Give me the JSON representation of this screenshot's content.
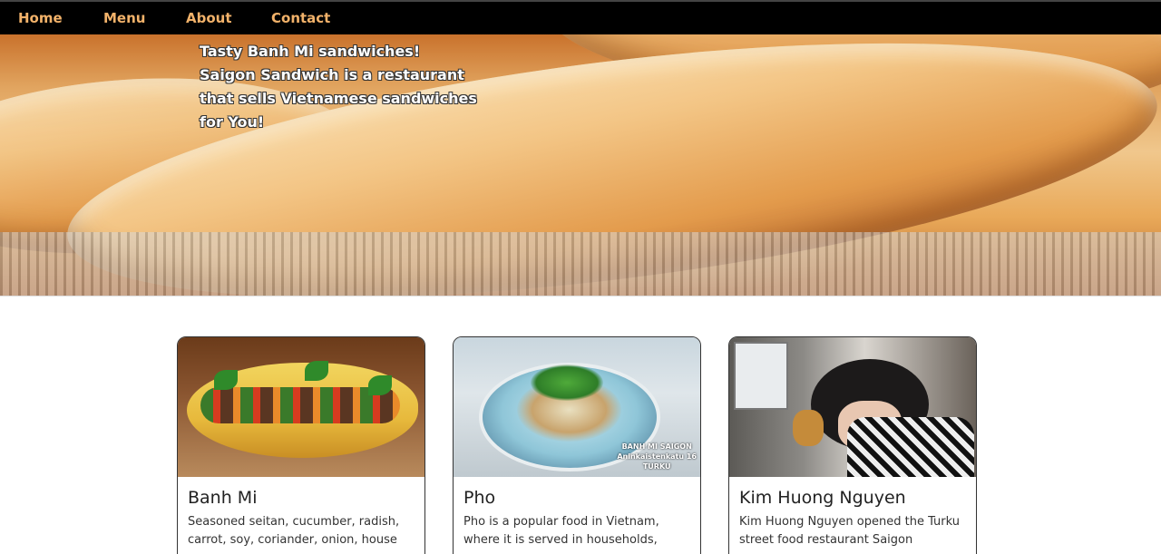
{
  "nav": {
    "items": [
      {
        "label": "Home"
      },
      {
        "label": "Menu"
      },
      {
        "label": "About"
      },
      {
        "label": "Contact"
      }
    ],
    "link_color": "#f2b26a",
    "background": "#000000"
  },
  "hero": {
    "lines": [
      "Tasty Banh Mi sandwiches!",
      "Saigon Sandwich is a restaurant",
      "that sells Vietnamese sandwiches",
      "for You!"
    ]
  },
  "cards": [
    {
      "title": "Banh Mi",
      "description": "Seasoned seitan, cucumber, radish, carrot, soy, coriander, onion, house"
    },
    {
      "title": "Pho",
      "description": "Pho is a popular food in Vietnam, where it is served in households,",
      "image_caption": [
        "BANH MI SAIGON",
        "Aninkaistenkatu 16",
        "TURKU"
      ]
    },
    {
      "title": "Kim Huong Nguyen",
      "description": "Kim Huong Nguyen opened the Turku street food restaurant Saigon"
    }
  ]
}
